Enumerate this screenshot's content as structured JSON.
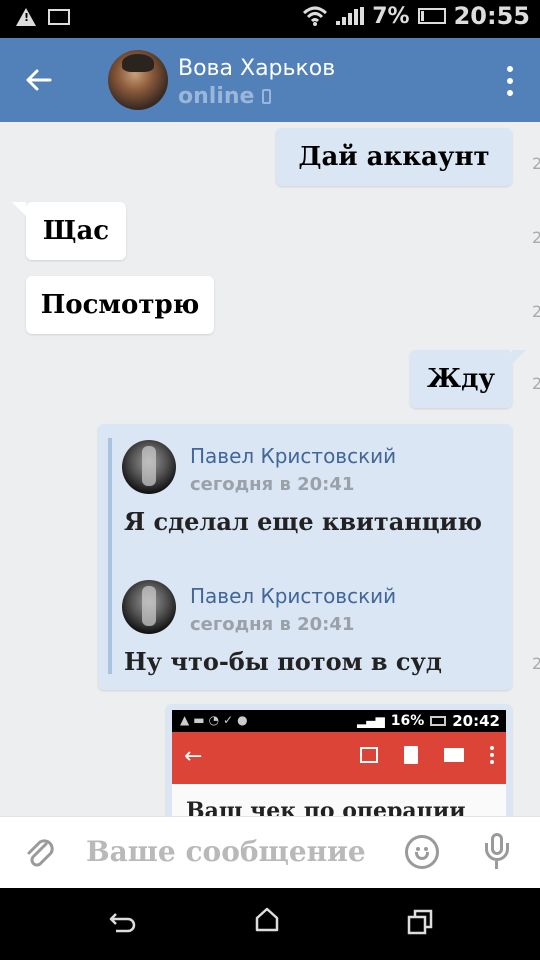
{
  "status_bar": {
    "battery_percent": "7%",
    "time": "20:55",
    "icons": [
      "warning-icon",
      "image-icon",
      "wifi-icon",
      "signal-icon",
      "battery-icon"
    ]
  },
  "header": {
    "contact_name": "Вова Харьков",
    "status": "online",
    "icons": [
      "back-arrow-icon",
      "phone-icon",
      "more-vertical-icon"
    ],
    "accent_color": "#5181b8"
  },
  "messages": [
    {
      "direction": "out",
      "text": "Дай аккаунт"
    },
    {
      "direction": "in",
      "text": "Щас"
    },
    {
      "direction": "in",
      "text": "Посмотрю"
    },
    {
      "direction": "out",
      "text": "Жду"
    }
  ],
  "forwarded": [
    {
      "author": "Павел Кристовский",
      "time": "сегодня в 20:41",
      "text": "Я сделал еще квитанцию"
    },
    {
      "author": "Павел Кристовский",
      "time": "сегодня в 20:41",
      "text": "Ну что-бы потом в суд"
    }
  ],
  "screenshot_attachment": {
    "battery_percent": "16%",
    "time": "20:42",
    "email_text": "Ваш чек по операции",
    "toolbar_color": "#db4437"
  },
  "input": {
    "placeholder": "Ваше сообщение",
    "icons": [
      "paperclip-icon",
      "smile-icon",
      "microphone-icon"
    ]
  },
  "nav_bar": {
    "icons": [
      "nav-back-icon",
      "nav-home-icon",
      "nav-recent-icon"
    ]
  }
}
